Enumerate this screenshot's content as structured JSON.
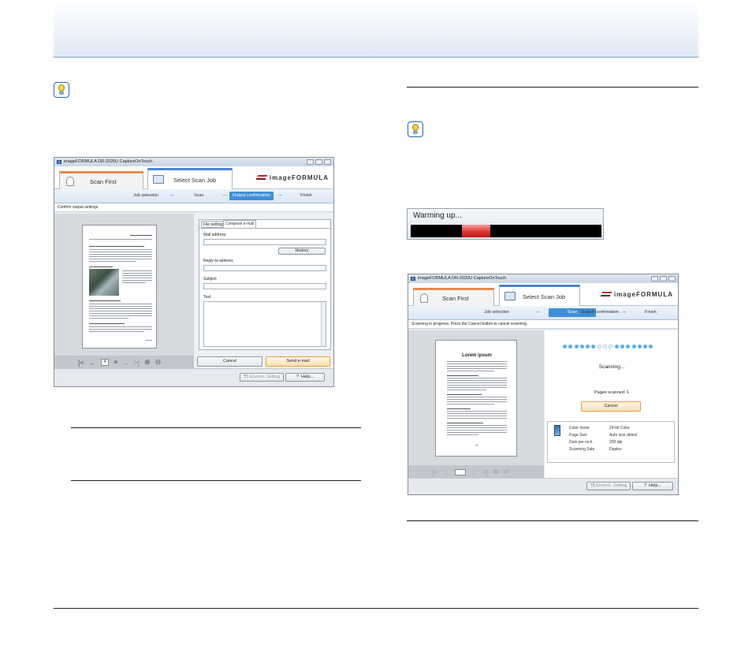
{
  "window1": {
    "title": "imageFORMULA DR-2020U CaptureOnTouch",
    "tab_scan_first": "Scan First",
    "tab_select_scan_job": "Select Scan Job",
    "brand": "imageFORMULA",
    "steps": [
      "Job selection",
      "Scan",
      "Output confirmation",
      "Finish"
    ],
    "current_step": "Output confirmation",
    "status": "Confirm output settings",
    "page_number": "4",
    "page_total": "/4",
    "form_tabs": [
      "File settings",
      "Compose e-mail"
    ],
    "labels": {
      "mail_address": "Mail address",
      "history": "History",
      "reply_to": "Reply-to address",
      "subject": "Subject",
      "text": "Text"
    },
    "cancel": "Cancel",
    "send": "Send e-mail",
    "environ": "Environ. Setting",
    "help_q": "?",
    "help": "Help..."
  },
  "warming": {
    "label": "Warming up...",
    "progress": 0.15,
    "progress_start": 0.27
  },
  "window2": {
    "title": "imageFORMULA DR-2020U CaptureOnTouch",
    "tab_scan_first": "Scan First",
    "tab_select_scan_job": "Select Scan Job",
    "brand": "imageFORMULA",
    "steps": [
      "Job selection",
      "Scan",
      "Output confirmation",
      "Finish"
    ],
    "current_step": "Scan",
    "status": "Scanning in progress. Press the Cancel button to cancel scanning.",
    "doc_title": "Lorem ipsum",
    "scanning": "Scanning...",
    "pages_scanned": "Pages scanned: 1",
    "cancel": "Cancel",
    "info_labels": [
      "Color mode",
      "Page Size",
      "Dots per inch",
      "Scanning Side"
    ],
    "info_values": [
      "24-bit Color",
      "Auto size detect",
      "200 dpi",
      "Duplex"
    ],
    "environ": "Environ. Setting",
    "help_q": "?",
    "help": "Help..."
  },
  "colors": {
    "accent": "#3f8fd8",
    "header_line": "#7aa1d6",
    "progress_red": "#e23a3a"
  }
}
